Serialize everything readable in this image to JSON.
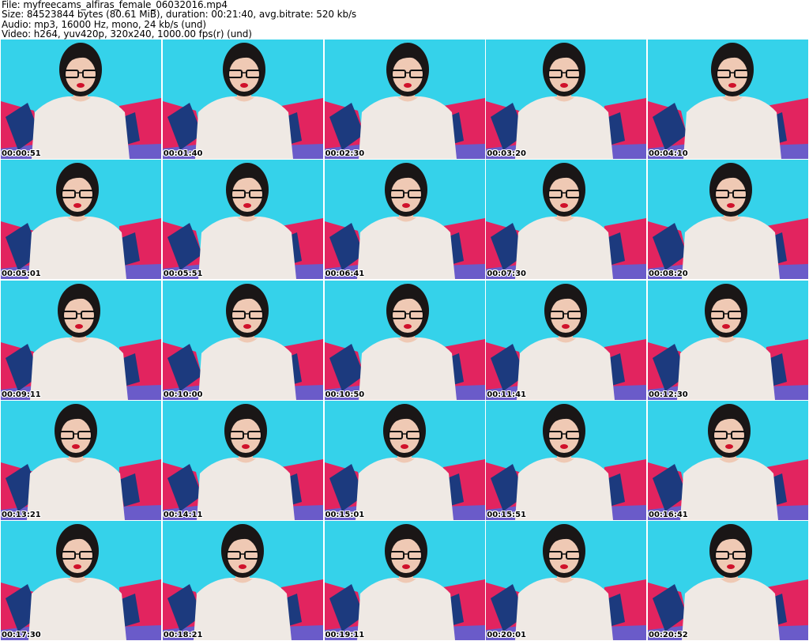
{
  "header": {
    "file_line": "File: myfreecams_alfiras_female_06032016.mp4",
    "size_line": "Size: 84523844 bytes (80.61 MiB), duration: 00:21:40, avg.bitrate: 520 kb/s",
    "audio_line": "Audio: mp3, 16000 Hz, mono, 24 kb/s (und)",
    "video_line": "Video: h264, yuv420p, 320x240, 1000.00 fps(r) (und)"
  },
  "thumbnails": [
    {
      "timestamp": "00:00:51"
    },
    {
      "timestamp": "00:01:40"
    },
    {
      "timestamp": "00:02:30"
    },
    {
      "timestamp": "00:03:20"
    },
    {
      "timestamp": "00:04:10"
    },
    {
      "timestamp": "00:05:01"
    },
    {
      "timestamp": "00:05:51"
    },
    {
      "timestamp": "00:06:41"
    },
    {
      "timestamp": "00:07:30"
    },
    {
      "timestamp": "00:08:20"
    },
    {
      "timestamp": "00:09:11"
    },
    {
      "timestamp": "00:10:00"
    },
    {
      "timestamp": "00:10:50"
    },
    {
      "timestamp": "00:11:41"
    },
    {
      "timestamp": "00:12:30"
    },
    {
      "timestamp": "00:13:21"
    },
    {
      "timestamp": "00:14:11"
    },
    {
      "timestamp": "00:15:01"
    },
    {
      "timestamp": "00:15:51"
    },
    {
      "timestamp": "00:16:41"
    },
    {
      "timestamp": "00:17:30"
    },
    {
      "timestamp": "00:18:21"
    },
    {
      "timestamp": "00:19:11"
    },
    {
      "timestamp": "00:20:01"
    },
    {
      "timestamp": "00:20:52"
    }
  ],
  "colors": {
    "background_wall": "#35d2ea",
    "pillow_pink": "#e2245f",
    "pillow_navy": "#1c3a7e",
    "bedding_purple": "#6a5bc9",
    "sweater": "#efe9e4",
    "hair": "#1a1616",
    "skin": "#efc9b4",
    "lips": "#d0102a"
  }
}
